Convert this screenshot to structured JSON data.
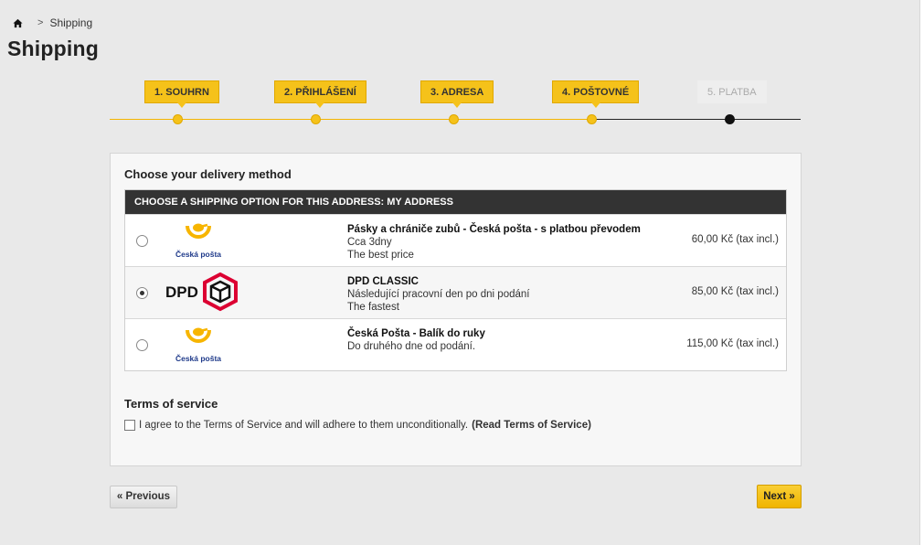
{
  "breadcrumb": {
    "icon": "home-icon",
    "separator": ">",
    "current": "Shipping"
  },
  "page_title": "Shipping",
  "steps": [
    {
      "label": "1. SOUHRN",
      "state": "done"
    },
    {
      "label": "2. PŘIHLÁŠENÍ",
      "state": "done"
    },
    {
      "label": "3. ADRESA",
      "state": "done"
    },
    {
      "label": "4. POŠTOVNÉ",
      "state": "current"
    },
    {
      "label": "5. PLATBA",
      "state": "inactive"
    }
  ],
  "delivery": {
    "heading": "Choose your delivery method",
    "table_header": "CHOOSE A SHIPPING OPTION FOR THIS ADDRESS: MY ADDRESS",
    "options": [
      {
        "selected": false,
        "logo": "ceska-posta-logo",
        "logo_text": "Česká pošta",
        "title": "Pásky a chrániče zubů - Česká pošta - s platbou převodem",
        "line1": "Cca 3dny",
        "line2": "The best price",
        "price": "60,00 Kč (tax incl.)"
      },
      {
        "selected": true,
        "logo": "dpd-logo",
        "logo_text": "DPD",
        "title": "DPD CLASSIC",
        "line1": "Následující pracovní den po dni podání",
        "line2": "The fastest",
        "price": "85,00 Kč (tax incl.)"
      },
      {
        "selected": false,
        "logo": "ceska-posta-logo",
        "logo_text": "Česká pošta",
        "title": "Česká Pošta - Balík do ruky",
        "line1": "Do druhého dne od podání.",
        "line2": "",
        "price": "115,00 Kč (tax incl.)"
      }
    ]
  },
  "terms": {
    "heading": "Terms of service",
    "checked": false,
    "text": "I agree to the Terms of Service and will adhere to them unconditionally.",
    "link": "(Read Terms of Service)"
  },
  "buttons": {
    "previous": "« Previous",
    "next": "Next »"
  },
  "colors": {
    "accent": "#f5c21a",
    "header_bg": "#333333",
    "page_bg": "#e9e9e9",
    "dpd_red": "#dc0032",
    "posta_yellow": "#f7b500",
    "posta_blue": "#1f3a8a"
  }
}
